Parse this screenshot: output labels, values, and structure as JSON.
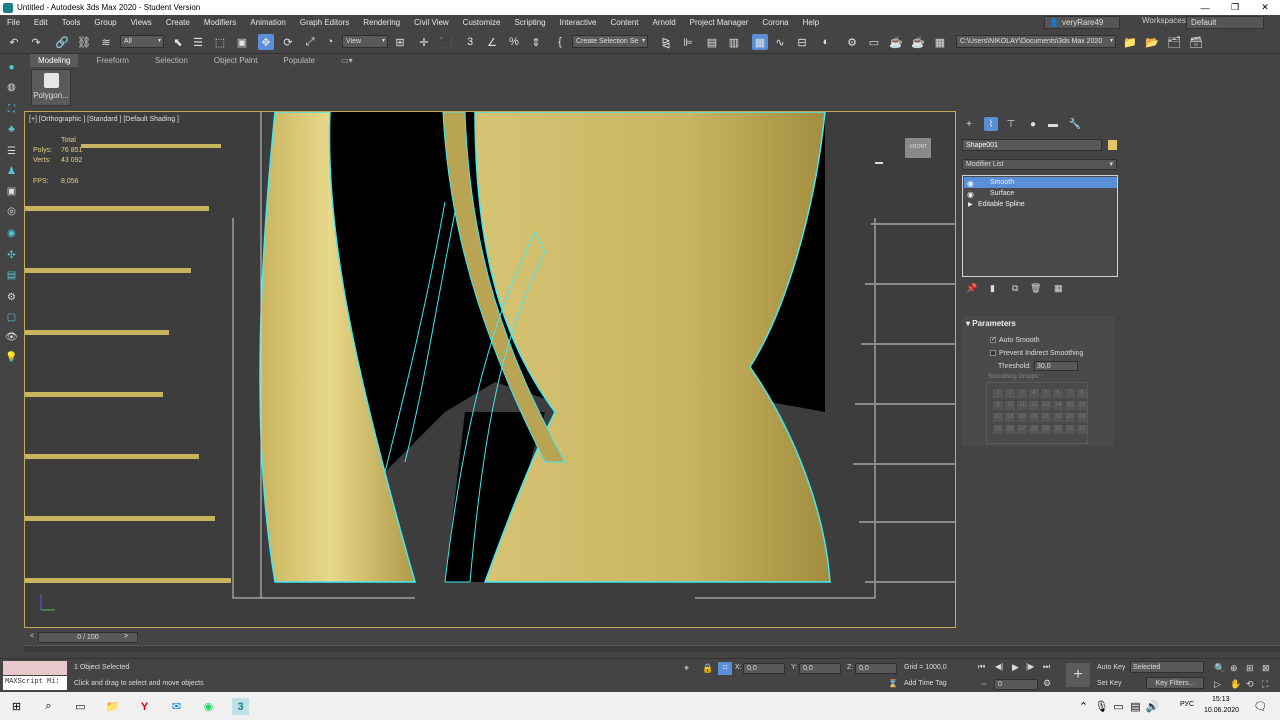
{
  "titlebar": {
    "title": "Untitled - Autodesk 3ds Max 2020 - Student Version",
    "minimize": "—",
    "maximize": "❐",
    "close": "✕"
  },
  "menubar": {
    "items": [
      "File",
      "Edit",
      "Tools",
      "Group",
      "Views",
      "Create",
      "Modifiers",
      "Animation",
      "Graph Editors",
      "Rendering",
      "Civil View",
      "Customize",
      "Scripting",
      "Interactive",
      "Content",
      "Arnold",
      "Project Manager",
      "Corona",
      "Help"
    ],
    "user": "veryRare49",
    "workspaces_label": "Workspaces:",
    "workspace": "Default"
  },
  "toolbar": {
    "selection_filter": "All",
    "ref_coord": "View",
    "selection_set": "Create Selection Se",
    "project_path": "C:\\Users\\NIKOLAY\\Documents\\3ds Max 2020"
  },
  "ribbon": {
    "tabs": [
      "Modeling",
      "Freeform",
      "Selection",
      "Object Paint",
      "Populate"
    ],
    "polygon_label": "Polygon..."
  },
  "viewport": {
    "label": "[+] [Orthographic ] [Standard ] [Default Shading ]",
    "stats": {
      "total_label": "Total",
      "polys_label": "Polys:",
      "polys": "76 851",
      "verts_label": "Verts:",
      "verts": "43 092",
      "fps_label": "FPS:",
      "fps": "8,056"
    },
    "viewcube_label": "FRONT"
  },
  "command_panel": {
    "object_name": "Shape001",
    "modifier_list": "Modifier List",
    "stack": [
      "Smooth",
      "Surface",
      "Editable Spline"
    ],
    "parameters": {
      "title": "Parameters",
      "auto_smooth": "Auto Smooth",
      "prevent_indirect": "Prevent Indirect Smoothing",
      "threshold_label": "Threshold:",
      "threshold": "30,0",
      "groups_label": "Smoothing Groups:",
      "groups": [
        "1",
        "2",
        "3",
        "4",
        "5",
        "6",
        "7",
        "8",
        "9",
        "10",
        "11",
        "12",
        "13",
        "14",
        "15",
        "16",
        "17",
        "18",
        "19",
        "20",
        "21",
        "22",
        "23",
        "24",
        "25",
        "26",
        "27",
        "28",
        "29",
        "30",
        "31",
        "32"
      ]
    }
  },
  "timeline": {
    "frame": "0 / 100"
  },
  "status": {
    "selection": "1 Object Selected",
    "prompt": "Click and drag to select and move objects",
    "maxscript": "MAXScript Mi:",
    "x_label": "X:",
    "x": "0,0",
    "y_label": "Y:",
    "y": "0,0",
    "z_label": "Z:",
    "z": "0,0",
    "grid": "Grid = 1000,0",
    "add_time_tag": "Add Time Tag",
    "auto_key": "Auto Key",
    "set_key": "Set Key",
    "selected": "Selected",
    "key_filters": "Key Filters...",
    "frame_field": "0"
  },
  "taskbar": {
    "time": "15:13",
    "date": "10.06.2020",
    "lang": "РУС"
  }
}
